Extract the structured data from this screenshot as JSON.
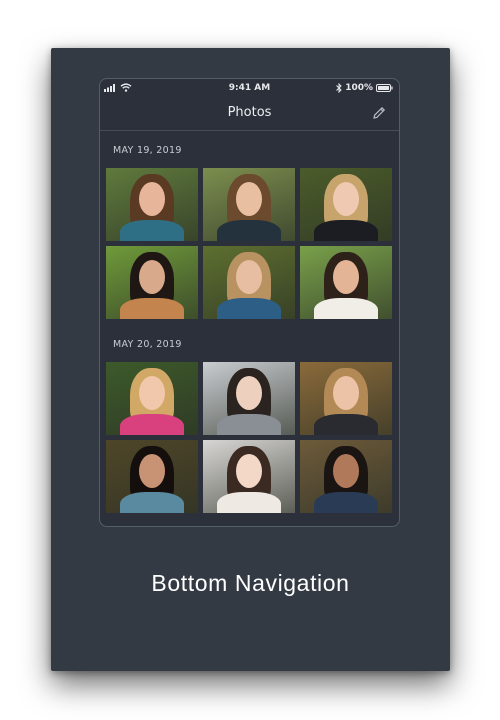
{
  "status_bar": {
    "time": "9:41 AM",
    "battery": "100%",
    "icons": [
      "signal-icon",
      "wifi-icon",
      "bluetooth-icon",
      "battery-icon"
    ]
  },
  "nav": {
    "title": "Photos",
    "edit_icon": "pencil-icon"
  },
  "sections": [
    {
      "date": "MAY 19, 2019",
      "photos": [
        {
          "bg": "#5f7a3c",
          "hair": "#5a3a22",
          "skin": "#e6b59a",
          "top": "#2f6f86"
        },
        {
          "bg": "#7c8e4e",
          "hair": "#6b4a2e",
          "skin": "#e9bfa2",
          "top": "#23323c"
        },
        {
          "bg": "#4b5c2a",
          "hair": "#c6a46c",
          "skin": "#efc9b1",
          "top": "#1b1d22"
        },
        {
          "bg": "#6f9a3a",
          "hair": "#1f1714",
          "skin": "#d9a98c",
          "top": "#c4844d"
        },
        {
          "bg": "#5d6f2f",
          "hair": "#b89260",
          "skin": "#e8bea3",
          "top": "#2d5e86"
        },
        {
          "bg": "#79a04a",
          "hair": "#2e211a",
          "skin": "#e3b496",
          "top": "#f1eee8"
        }
      ]
    },
    {
      "date": "MAY 20, 2019",
      "photos": [
        {
          "bg": "#3d5a2a",
          "hair": "#d2a866",
          "skin": "#f1c8ab",
          "top": "#d8407e"
        },
        {
          "bg": "#c9ccd0",
          "hair": "#2a2320",
          "skin": "#edd0bd",
          "top": "#8a8f96"
        },
        {
          "bg": "#8a6a3a",
          "hair": "#b38a55",
          "skin": "#edc3a7",
          "top": "#2a2b30"
        },
        {
          "bg": "#4f4628",
          "hair": "#140f0d",
          "skin": "#c89274",
          "top": "#5a8aa0"
        },
        {
          "bg": "#d8d6d4",
          "hair": "#3a2a22",
          "skin": "#f3d8c8",
          "top": "#efe9e4"
        },
        {
          "bg": "#6d5a3a",
          "hair": "#1a1412",
          "skin": "#b07a5a",
          "top": "#2a3b55"
        }
      ]
    }
  ],
  "caption": "Bottom Navigation"
}
